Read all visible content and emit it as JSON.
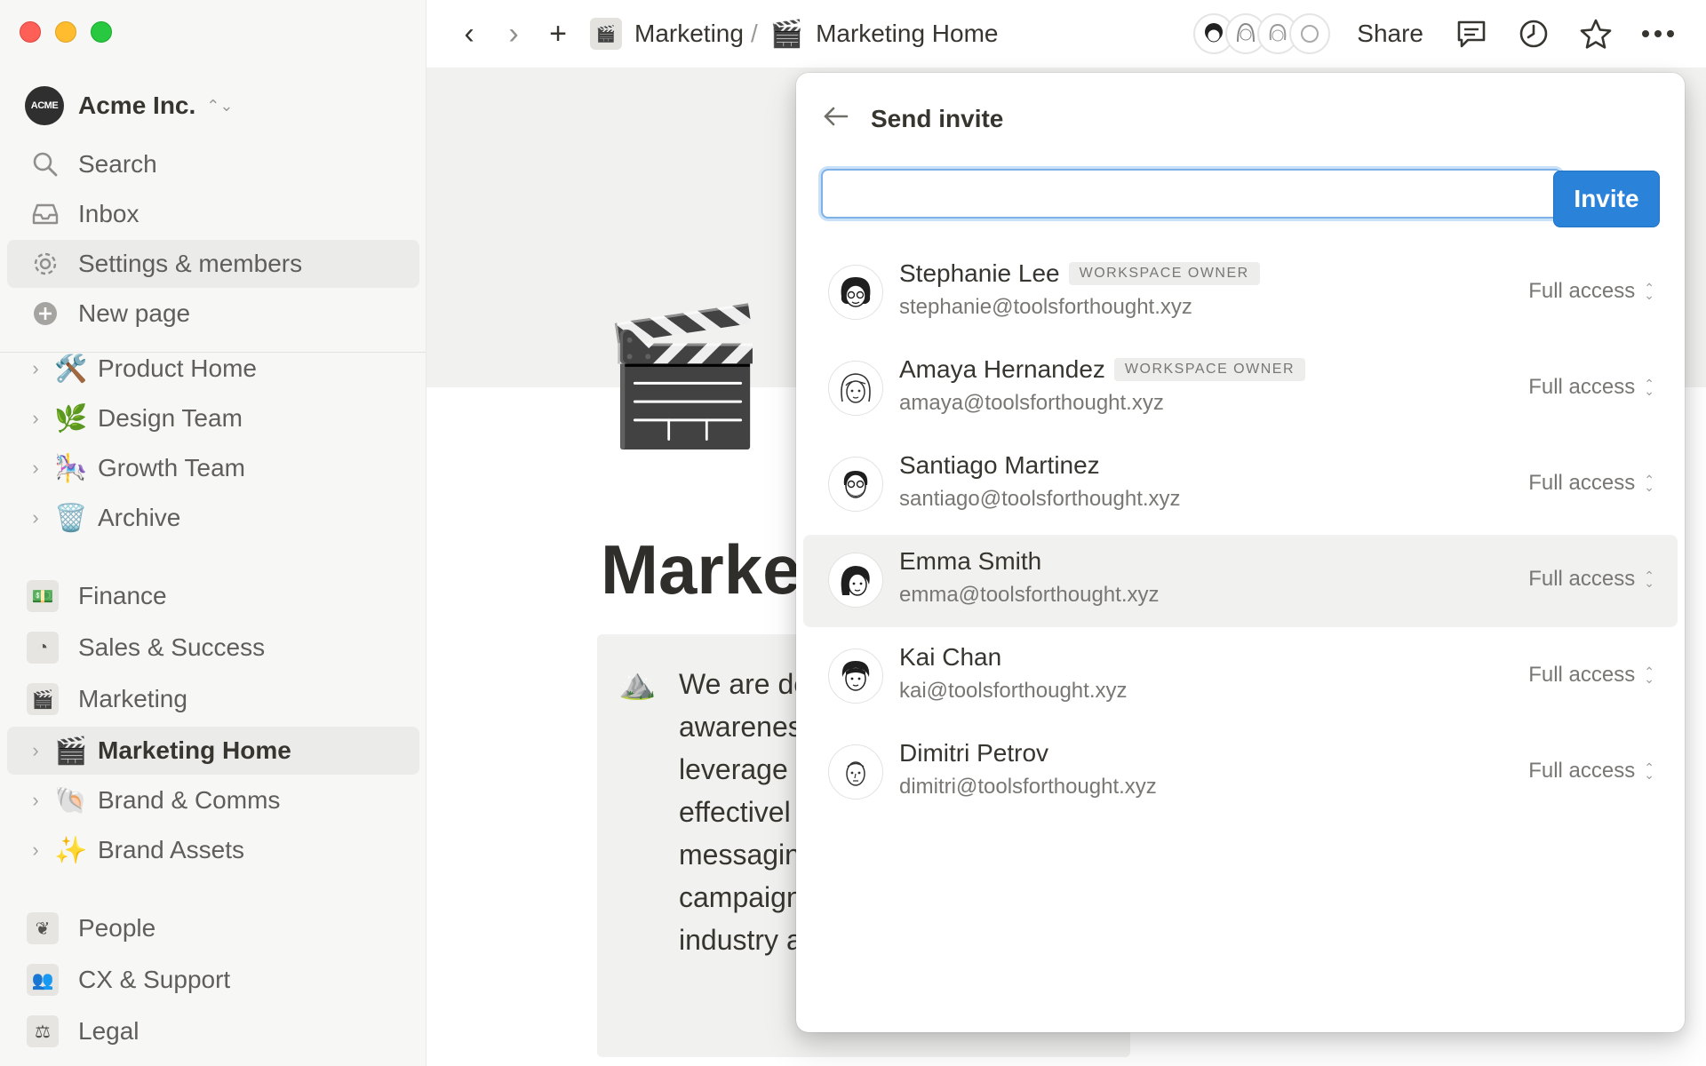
{
  "sidebar": {
    "workspace": {
      "logo": "ACME",
      "name": "Acme Inc."
    },
    "actions": [
      {
        "label": "Search",
        "icon": "search-icon"
      },
      {
        "label": "Inbox",
        "icon": "inbox-icon"
      },
      {
        "label": "Settings & members",
        "icon": "gear-icon"
      },
      {
        "label": "New page",
        "icon": "plus-circle-icon"
      }
    ],
    "pages": [
      {
        "label": "Product Home",
        "emoji": "🛠️"
      },
      {
        "label": "Design Team",
        "emoji": "🌿"
      },
      {
        "label": "Growth Team",
        "emoji": "🎠"
      },
      {
        "label": "Archive",
        "emoji": "🗑️"
      }
    ],
    "teamspaces": [
      {
        "label": "Finance",
        "icon": "💵"
      },
      {
        "label": "Sales & Success",
        "icon": "◔"
      },
      {
        "label": "Marketing",
        "icon": "🎬"
      }
    ],
    "marketing_pages": [
      {
        "label": "Marketing Home",
        "emoji": "🎬"
      },
      {
        "label": "Brand & Comms",
        "emoji": "🐚"
      },
      {
        "label": "Brand Assets",
        "emoji": "✨"
      }
    ],
    "bottom_teamspaces": [
      {
        "label": "People",
        "icon": "❦"
      },
      {
        "label": "CX & Support",
        "icon": "👥"
      },
      {
        "label": "Legal",
        "icon": "⚖"
      }
    ]
  },
  "topbar": {
    "breadcrumb": [
      {
        "label": "Marketing",
        "icon": "🎬"
      },
      {
        "label": "Marketing Home",
        "emoji": "🎬"
      }
    ],
    "separator": "/",
    "share_label": "Share"
  },
  "page": {
    "icon": "🎬",
    "title": "Marketing Home",
    "callout_emoji": "⛰️",
    "callout_text": "We are de\nawarenes\nleverage\neffectivel\nmessagin\ncampaign\nindustry a"
  },
  "invite_modal": {
    "title": "Send invite",
    "input_value": "",
    "input_placeholder": "",
    "invite_label": "Invite",
    "members": [
      {
        "name": "Stephanie Lee",
        "badge": "WORKSPACE OWNER",
        "email": "stephanie@toolsforthought.xyz",
        "access": "Full access"
      },
      {
        "name": "Amaya Hernandez",
        "badge": "WORKSPACE OWNER",
        "email": "amaya@toolsforthought.xyz",
        "access": "Full access"
      },
      {
        "name": "Santiago Martinez",
        "badge": "",
        "email": "santiago@toolsforthought.xyz",
        "access": "Full access"
      },
      {
        "name": "Emma Smith",
        "badge": "",
        "email": "emma@toolsforthought.xyz",
        "access": "Full access"
      },
      {
        "name": "Kai Chan",
        "badge": "",
        "email": "kai@toolsforthought.xyz",
        "access": "Full access"
      },
      {
        "name": "Dimitri Petrov",
        "badge": "",
        "email": "dimitri@toolsforthought.xyz",
        "access": "Full access"
      }
    ]
  },
  "colors": {
    "accent": "#2b83d9",
    "sidebar_bg": "#f7f7f5",
    "text": "#37352f"
  }
}
